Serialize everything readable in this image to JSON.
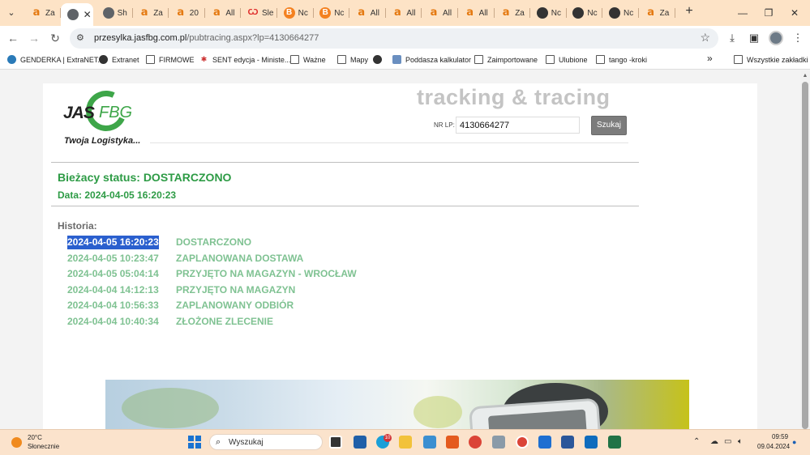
{
  "browser": {
    "tabs": [
      {
        "title": "Za",
        "icon": "amazon"
      },
      {
        "title": "",
        "icon": "globe",
        "active": true
      },
      {
        "title": "Sh",
        "icon": "globe"
      },
      {
        "title": "Za",
        "icon": "amazon"
      },
      {
        "title": "20",
        "icon": "amazon"
      },
      {
        "title": "All",
        "icon": "amazon"
      },
      {
        "title": "Śle",
        "icon": "red"
      },
      {
        "title": "Nc",
        "icon": "orange-circle"
      },
      {
        "title": "Nc",
        "icon": "orange-circle"
      },
      {
        "title": "All",
        "icon": "amazon"
      },
      {
        "title": "All",
        "icon": "amazon"
      },
      {
        "title": "All",
        "icon": "amazon"
      },
      {
        "title": "All",
        "icon": "amazon"
      },
      {
        "title": "Za",
        "icon": "amazon"
      },
      {
        "title": "Nc",
        "icon": "gh"
      },
      {
        "title": "Nc",
        "icon": "gh"
      },
      {
        "title": "Nc",
        "icon": "gh"
      },
      {
        "title": "Za",
        "icon": "amazon"
      }
    ],
    "address": {
      "host": "przesylka.jasfbg.com.pl",
      "path": "/pubtracing.aspx?lp=4130664277"
    },
    "bookmarks": [
      {
        "label": "GENDERKA | ExtraNET...",
        "icon": "wordpress"
      },
      {
        "label": "Extranet",
        "icon": "globe"
      },
      {
        "label": "FIRMOWE",
        "icon": "folder"
      },
      {
        "label": "SENT edycja - Ministe...",
        "icon": "sent"
      },
      {
        "label": "Ważne",
        "icon": "folder"
      },
      {
        "label": "Mapy",
        "icon": "folder"
      },
      {
        "label": "",
        "icon": "globe"
      },
      {
        "label": "Poddasza kalkulator",
        "icon": "calculator"
      },
      {
        "label": "Zaimportowane",
        "icon": "folder"
      },
      {
        "label": "Ulubione",
        "icon": "folder"
      },
      {
        "label": "tango -kroki",
        "icon": "folder"
      }
    ],
    "bookmarks_overflow": "»",
    "all_bookmarks": "Wszystkie zakładki"
  },
  "page": {
    "logo_jas": "JAS",
    "logo_fbg": "FBG",
    "slogan": "Twoja Logistyka...",
    "tracking_title": "tracking & tracing",
    "nrlp_label": "NR LP:",
    "nrlp_value": "4130664277",
    "search_button": "Szukaj",
    "current_status": "Bieżacy status: DOSTARCZONO",
    "current_date": "Data: 2024-04-05 16:20:23",
    "history_label": "Historia:",
    "history": [
      {
        "date": "2024-04-05 16:20:23",
        "event": "DOSTARCZONO",
        "selected": true
      },
      {
        "date": "2024-04-05 10:23:47",
        "event": "ZAPLANOWANA DOSTAWA"
      },
      {
        "date": "2024-04-05 05:04:14",
        "event": "PRZYJĘTO NA MAGAZYN - WROCŁAW"
      },
      {
        "date": "2024-04-04 14:12:13",
        "event": "PRZYJĘTO NA MAGAZYN"
      },
      {
        "date": "2024-04-04 10:56:33",
        "event": "ZAPLANOWANY ODBIÓR"
      },
      {
        "date": "2024-04-04 10:40:34",
        "event": "ZŁOŻONE ZLECENIE"
      }
    ]
  },
  "taskbar": {
    "weather_temp": "20°C",
    "weather_desc": "Słonecznie",
    "search_placeholder": "Wyszukaj",
    "badge_count": "10",
    "clock_time": "09:59",
    "clock_date": "09.04.2024"
  },
  "colors": {
    "status_green": "#2d9b45",
    "history_green": "#7fc292",
    "selection_blue": "#2a5fce"
  }
}
